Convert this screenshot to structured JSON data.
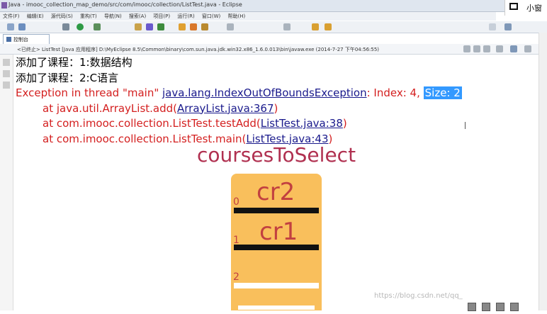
{
  "window": {
    "title": "Java - imooc_collection_map_demo/src/com/imooc/collection/ListTest.java - Eclipse"
  },
  "menu": [
    "文件(F)",
    "编辑(E)",
    "源代码(S)",
    "重构(T)",
    "导航(N)",
    "搜索(A)",
    "项目(P)",
    "运行(R)",
    "窗口(W)",
    "帮助(H)"
  ],
  "overlay_badge": {
    "label": "小窗"
  },
  "console": {
    "tab_label": "控制台",
    "status": "<已终止> ListTest [Java 应用程序] D:\\MyEclipse 8.5\\Common\\binary\\com.sun.java.jdk.win32.x86_1.6.0.013\\bin\\javaw.exe (2014-7-27 下午04:56:55)",
    "out1": "添加了课程：1:数据结构",
    "out2": "添加了课程：2:C语言",
    "err_prefix": "Exception in thread \"main\" ",
    "err_link": "java.lang.IndexOutOfBoundsException",
    "err_mid": ": Index: 4, ",
    "err_sel": "Size: 2",
    "st1_pre": "at java.util.ArrayList.add(",
    "st1_link": "ArrayList.java:367",
    "st2_pre": "at com.imooc.collection.ListTest.testAdd(",
    "st2_link": "ListTest.java:38",
    "st3_pre": "at com.imooc.collection.ListTest.main(",
    "st3_link": "ListTest.java:43",
    "close_paren": ")"
  },
  "overlay": {
    "title": "coursesToSelect",
    "slots": [
      {
        "index": "0",
        "value": "cr2"
      },
      {
        "index": "1",
        "value": "cr1"
      },
      {
        "index": "2",
        "value": ""
      }
    ]
  },
  "watermark": "https://blog.csdn.net/qq_",
  "colors": {
    "error": "#d42020",
    "link": "#1a1a8c",
    "selection": "#3399ff",
    "rack": "#f9bf5c",
    "overlay_text": "#b03050"
  }
}
